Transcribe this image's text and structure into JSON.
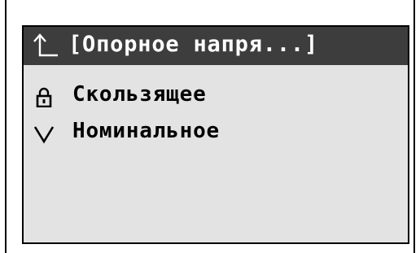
{
  "header": {
    "title": "[Опорное напря...]",
    "back_icon": "back-up-arrow-icon"
  },
  "menu": {
    "items": [
      {
        "label": "Скользящее",
        "icon": "lock-icon"
      },
      {
        "label": "Номинальное",
        "icon": "checkmark-icon"
      }
    ]
  },
  "colors": {
    "title_bar_bg": "#3d3d3d",
    "title_text": "#ffffff",
    "screen_bg": "#e3e3e3",
    "text": "#000000"
  }
}
